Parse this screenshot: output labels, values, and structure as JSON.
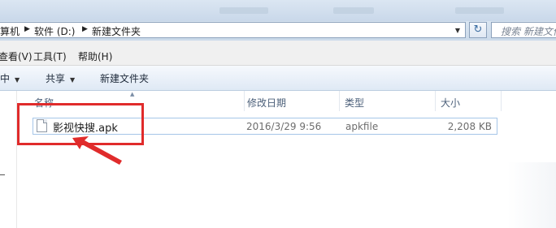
{
  "address": {
    "crumbs": [
      "算机",
      "软件 (D:)",
      "新建文件夹"
    ],
    "search_placeholder": "搜索 新建文件夹"
  },
  "menu": [
    "查看(V)",
    "工具(T)",
    "帮助(H)"
  ],
  "commands": {
    "include_label": "中",
    "share_label": "共享",
    "new_folder_label": "新建文件夹"
  },
  "columns": {
    "name": "名称",
    "modified": "修改日期",
    "type": "类型",
    "size": "大小"
  },
  "files": [
    {
      "name": "影视快搜.apk",
      "modified": "2016/3/29 9:56",
      "type": "apkfile",
      "size": "2,208 KB"
    }
  ],
  "annotation": {
    "highlight_color": "#e02b2b"
  },
  "icons": [
    "dropdown-icon",
    "refresh-icon",
    "file-icon",
    "sort-arrow-icon"
  ]
}
